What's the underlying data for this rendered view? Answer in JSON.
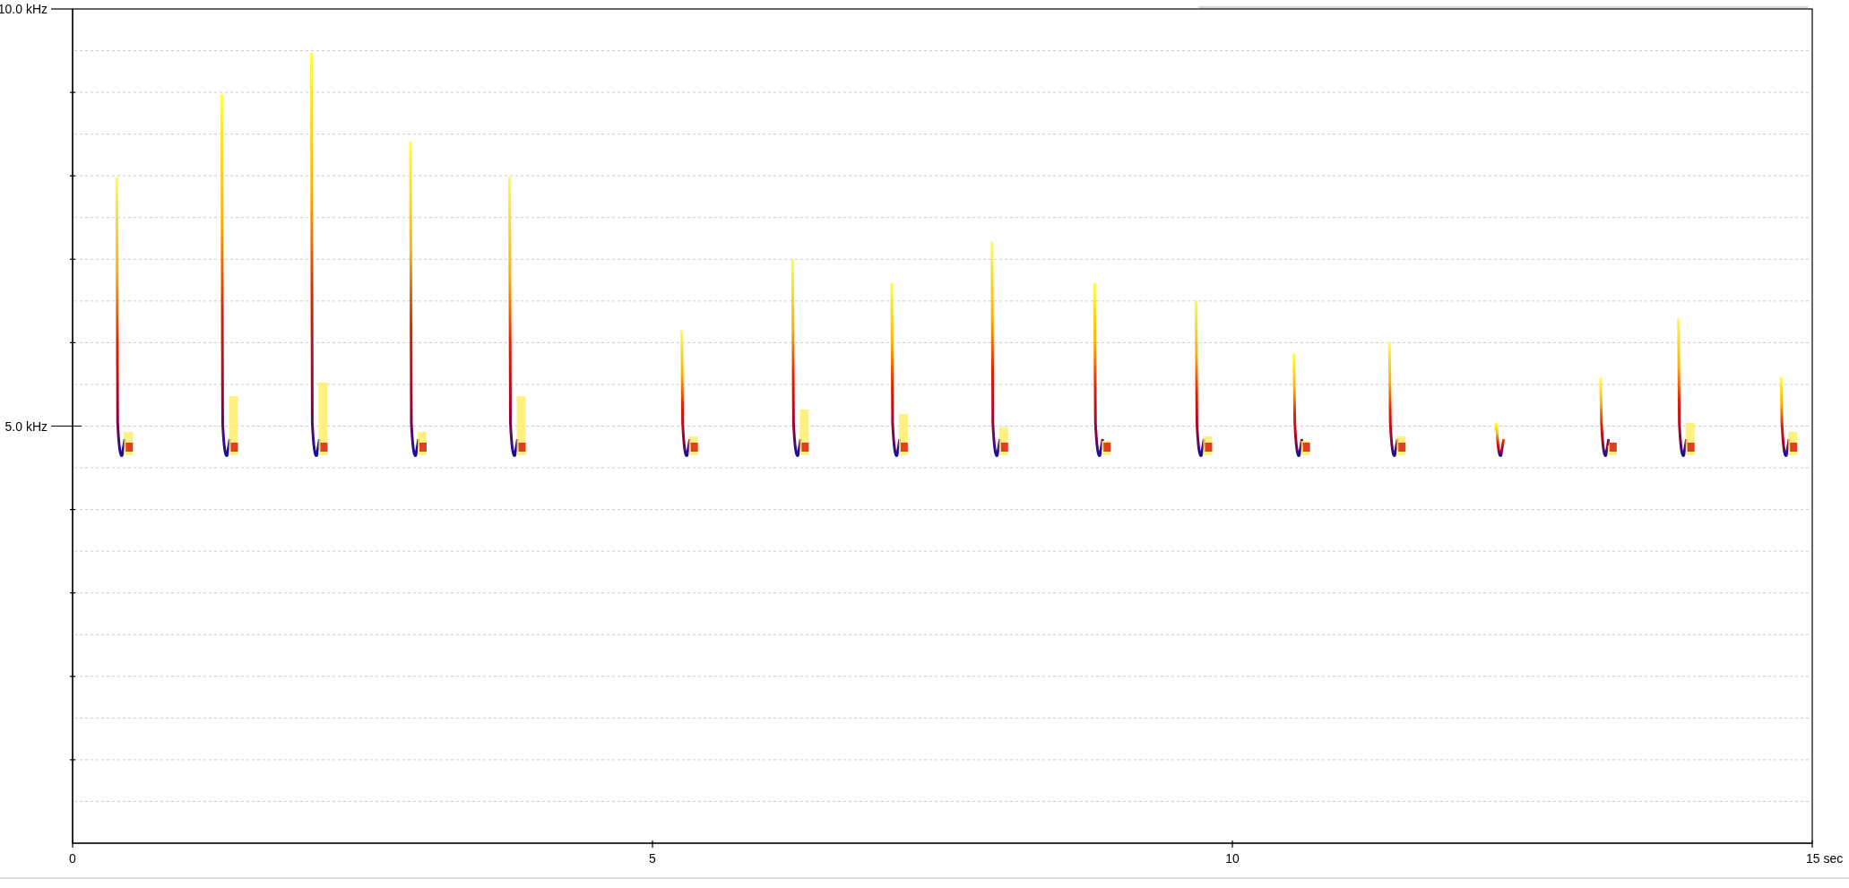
{
  "spectrogram": {
    "y_axis": {
      "labels": [
        "10.0 kHz",
        "5.0 kHz"
      ]
    },
    "x_axis": {
      "labels": [
        "0",
        "5",
        "10",
        "15 sec"
      ]
    }
  }
}
